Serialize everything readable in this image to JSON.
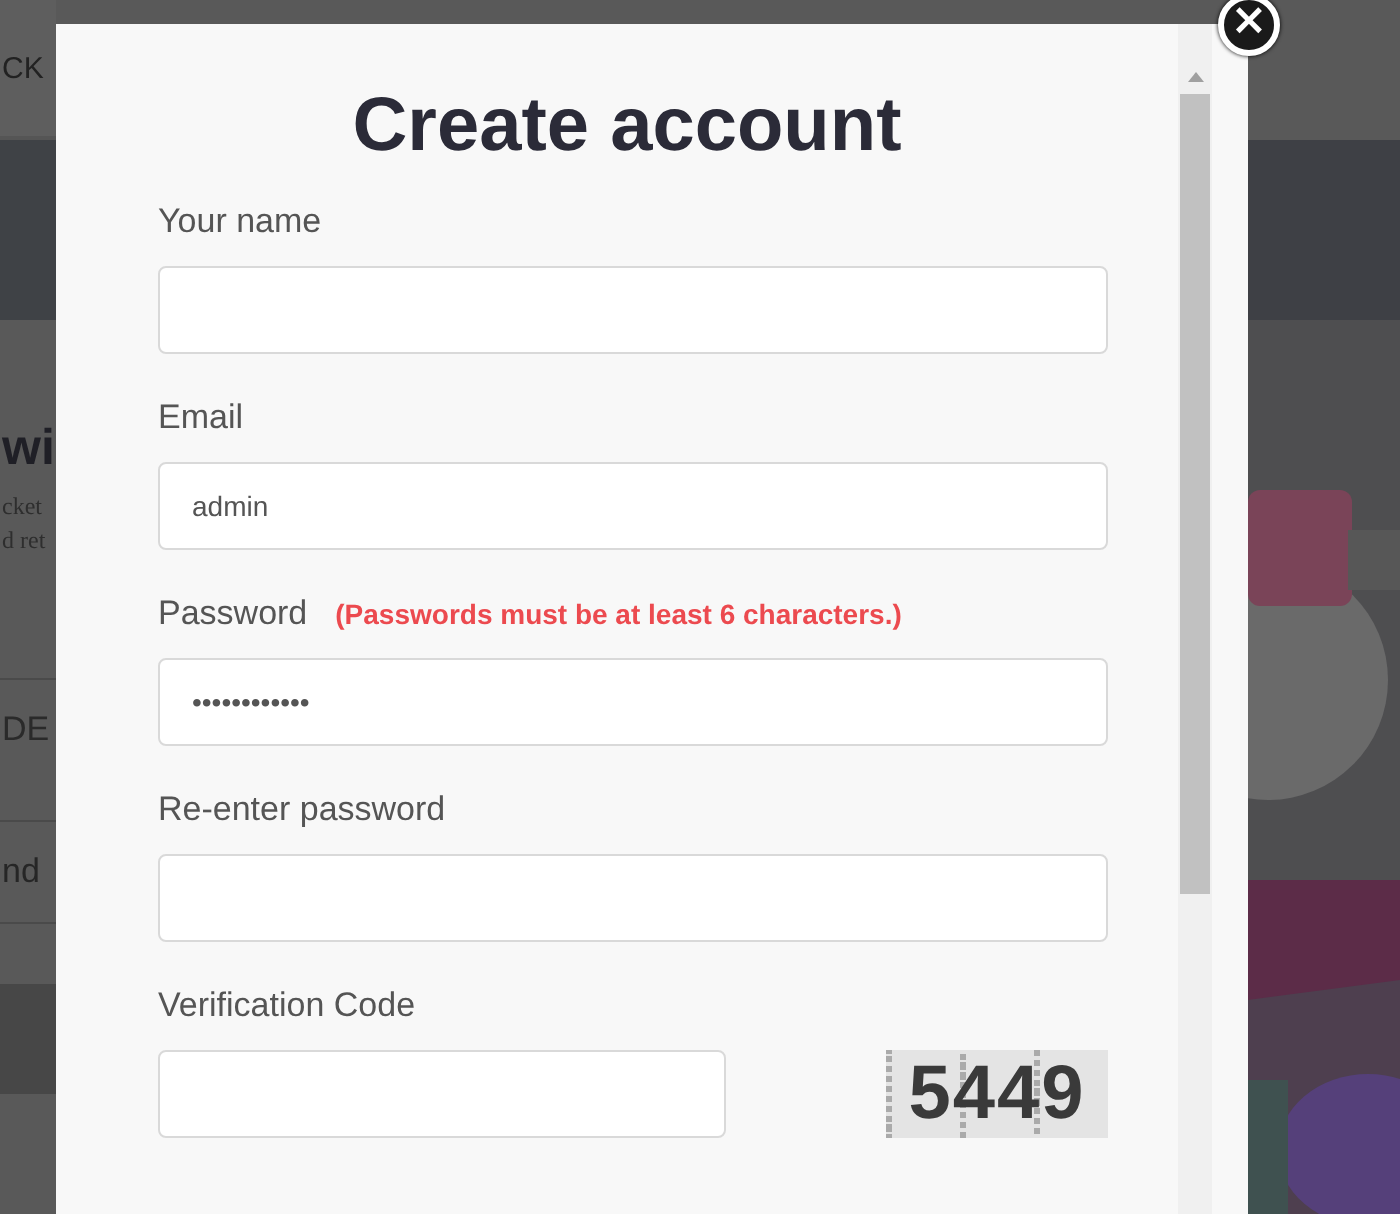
{
  "background_page": {
    "header_text": "CK",
    "heading": "wi",
    "body_lines": [
      "cket",
      "d ret"
    ],
    "row_1": "DE",
    "row_2": "nd"
  },
  "modal": {
    "title": "Create account",
    "close_label": "×",
    "fields": [
      {
        "kind": "text",
        "label": "Your name"
      },
      {
        "kind": "text",
        "label": "Email",
        "value": "admin"
      },
      {
        "kind": "text",
        "label": "Password",
        "note": "(Passwords must be at least 6 characters.)",
        "value": "••••••••••••"
      },
      {
        "kind": "text",
        "label": "Re-enter password"
      },
      {
        "kind": "captcha",
        "label": "Verification Code",
        "code": "5449"
      }
    ]
  }
}
